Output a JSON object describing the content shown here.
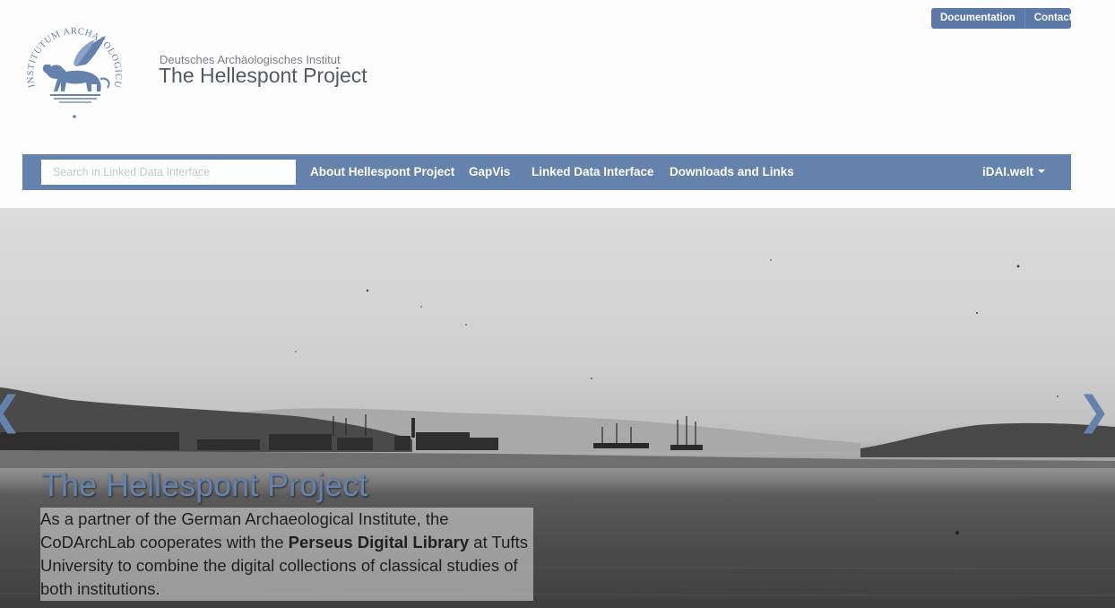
{
  "utility": {
    "documentation_label": "Documentation",
    "contact_label": "Contact"
  },
  "header": {
    "logo_icon": "griffin-seal-icon",
    "logo_text": "INSTITUTUM ARCHAEOLOGICUM GERMANICUM",
    "subtitle": "Deutsches Archäologisches Institut",
    "title": "The Hellespont Project"
  },
  "nav": {
    "search_placeholder": "Search in Linked Data Interface",
    "items": [
      {
        "label": "About Hellespont Project"
      },
      {
        "label": "GapVis"
      },
      {
        "label": "Linked Data Interface"
      },
      {
        "label": "Downloads and Links"
      }
    ],
    "dropdown_label": "iDAI.welt"
  },
  "hero": {
    "prev_icon": "chevron-left-icon",
    "next_icon": "chevron-right-icon",
    "caption_title": "The Hellespont Project",
    "caption_text_1": "As a partner of the German Archaeological Institute, the CoDArchLab cooperates with the ",
    "caption_bold": "Perseus Digital Library",
    "caption_text_2": " at Tufts University to combine the digital collections of classical studies of both institutions."
  },
  "colors": {
    "accent": "#6582ad",
    "utility_button": "#5a79a8",
    "brand_text": "#555a60"
  }
}
